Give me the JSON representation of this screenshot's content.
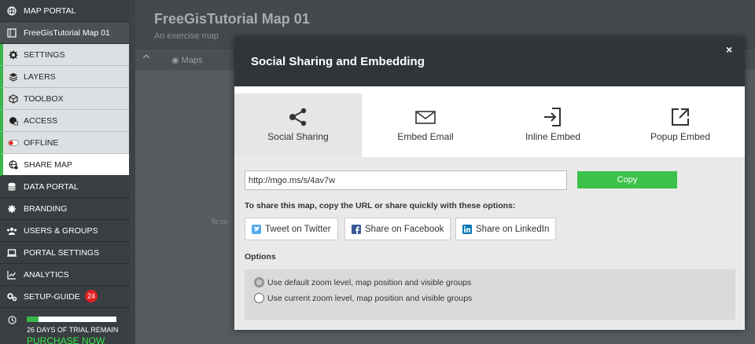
{
  "sidebar": {
    "items": [
      {
        "label": "MAP PORTAL",
        "icon": "globe-icon"
      },
      {
        "label": "FreeGisTutorial Map 01",
        "icon": "map-icon"
      },
      {
        "label": "SETTINGS",
        "icon": "gear-icon"
      },
      {
        "label": "LAYERS",
        "icon": "layers-icon"
      },
      {
        "label": "TOOLBOX",
        "icon": "box-icon"
      },
      {
        "label": "ACCESS",
        "icon": "globe-lock-icon"
      },
      {
        "label": "OFFLINE",
        "icon": "toggle-icon"
      },
      {
        "label": "SHARE MAP",
        "icon": "globe-share-icon"
      },
      {
        "label": "DATA PORTAL",
        "icon": "database-icon"
      },
      {
        "label": "BRANDING",
        "icon": "gear-small-icon"
      },
      {
        "label": "USERS & GROUPS",
        "icon": "users-icon"
      },
      {
        "label": "PORTAL SETTINGS",
        "icon": "laptop-icon"
      },
      {
        "label": "ANALYTICS",
        "icon": "chart-icon"
      },
      {
        "label": "SETUP-GUIDE",
        "icon": "gears-icon"
      }
    ],
    "setup_badge": "24",
    "trial": {
      "days_text": "26 DAYS OF TRIAL REMAIN",
      "purchase_text": "PURCHASE NOW",
      "progress": 0.13
    }
  },
  "background": {
    "title": "FreeGisTutorial Map 01",
    "subtitle": "An exercise map",
    "toolbar_chevron": "^",
    "toolbar_maps": "Maps",
    "hint": "To co"
  },
  "modal": {
    "title": "Social Sharing and Embedding",
    "close": "×",
    "tabs": [
      {
        "label": "Social Sharing",
        "icon": "share-icon"
      },
      {
        "label": "Embed Email",
        "icon": "envelope-icon"
      },
      {
        "label": "Inline Embed",
        "icon": "enter-icon"
      },
      {
        "label": "Popup Embed",
        "icon": "external-link-icon"
      }
    ],
    "url": "http://mgo.ms/s/4av7w",
    "copy_label": "Copy",
    "share_instructions": "To share this map, copy the URL or share quickly with these options:",
    "share_buttons": [
      {
        "label": "Tweet on Twitter",
        "icon": "twitter-icon"
      },
      {
        "label": "Share on Facebook",
        "icon": "facebook-icon"
      },
      {
        "label": "Share on LinkedIn",
        "icon": "linkedin-icon"
      }
    ],
    "options_title": "Options",
    "options": [
      {
        "label": "Use default zoom level, map position and visible groups",
        "selected": true
      },
      {
        "label": "Use current zoom level, map position and visible groups",
        "selected": false
      }
    ]
  },
  "colors": {
    "accent_green": "#39b54a",
    "copy_button": "#3cc24b",
    "modal_header": "#2f3539",
    "badge_red": "#e02020"
  }
}
